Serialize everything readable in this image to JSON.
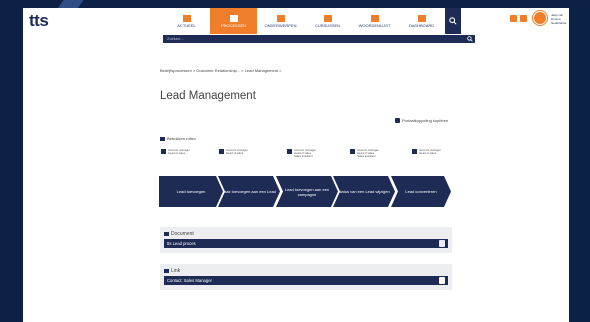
{
  "header": {
    "logo": "tts",
    "nav": [
      {
        "label": "ACTUEEL",
        "active": false
      },
      {
        "label": "PROCESSEN",
        "active": true
      },
      {
        "label": "ONDERWERPEN",
        "active": false
      },
      {
        "label": "CURSUSSEN",
        "active": false
      },
      {
        "label": "WOORDENLIJST",
        "active": false
      },
      {
        "label": "DASHBOARD",
        "active": false
      }
    ],
    "user_name": "Jaap van Doorne",
    "user_org": "Nederlands"
  },
  "search": {
    "placeholder": "Zoeken..."
  },
  "breadcrumb": "Bedrijfsprocessen > Customer Relationship... > Lead Management >",
  "page_title": "Lead Management",
  "portal_link": "Portaalkoppeling kopiëren",
  "roles": {
    "title": "Betrokken rollen",
    "items": [
      {
        "line1": "Account manager",
        "line2": "Head of sales"
      },
      {
        "line1": "Account manager",
        "line2": "Head of sales"
      },
      {
        "line1": "Account manager",
        "line2": "Head of sales",
        "line3": "Sales assistent"
      },
      {
        "line1": "Account manager",
        "line2": "Head of sales",
        "line3": "Sales assistent"
      },
      {
        "line1": "Account manager",
        "line2": "Head of sales"
      }
    ]
  },
  "process_steps": [
    "Lead toevoegen",
    "Taak toevoegen aan een Lead",
    "Lead toevoegen aan een campagne",
    "status van een Lead wijzigen",
    "Lead converteren"
  ],
  "document_section": {
    "title": "Document",
    "item": "tts Lead proces"
  },
  "link_section": {
    "title": "Link",
    "item": "Contact: Sales Manager"
  },
  "colors": {
    "navy": "#1d2b55",
    "orange": "#f07d2a",
    "frame": "#0d2147"
  }
}
